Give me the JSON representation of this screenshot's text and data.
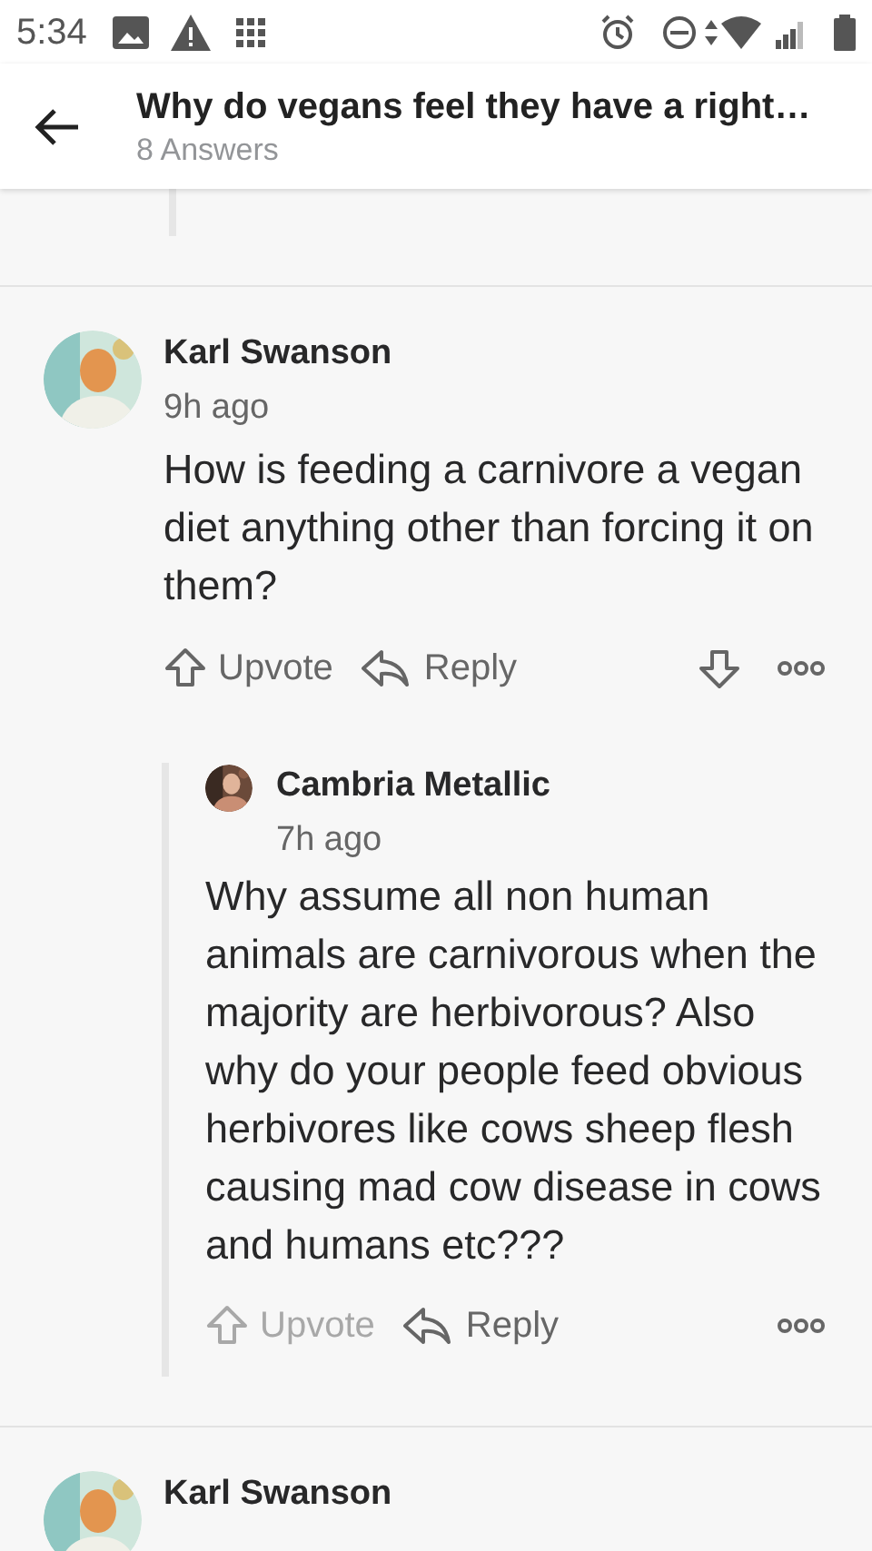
{
  "status_bar": {
    "time": "5:34"
  },
  "header": {
    "title": "Why do vegans feel they have a right…",
    "subtitle": "8 Answers"
  },
  "comments": [
    {
      "author": "Karl Swanson",
      "time": "9h ago",
      "body": "How is feeding a carnivore a vegan diet anything other than forcing it on them?",
      "upvote": {
        "label": "Upvote",
        "disabled": false
      },
      "reply": "Reply",
      "downvote": true,
      "replies": [
        {
          "author": "Cambria Metallic",
          "time": "7h ago",
          "body": "Why assume all non human animals are carnivorous when the majority are herbivorous? Also why do your people feed obvious herbivores like cows sheep flesh causing mad cow disease in cows and humans etc???",
          "upvote": {
            "label": "Upvote",
            "disabled": true
          },
          "reply": "Reply",
          "downvote": false
        }
      ]
    },
    {
      "author": "Karl Swanson"
    }
  ]
}
